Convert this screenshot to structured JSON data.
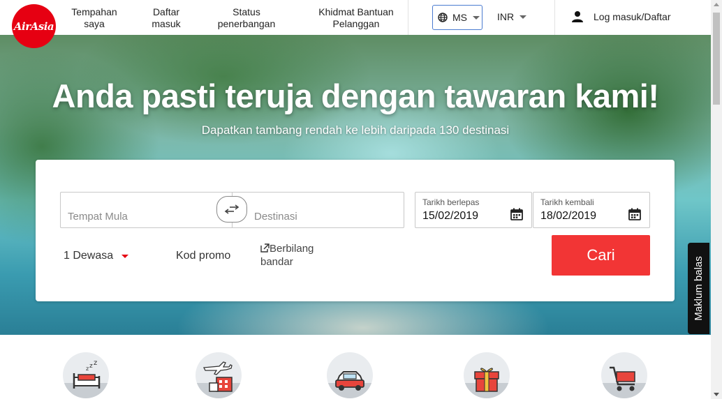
{
  "header": {
    "logo_text": "AirAsia",
    "nav": [
      "Tempahan saya",
      "Daftar masuk",
      "Status penerbangan",
      "Khidmat Bantuan Pelanggan"
    ],
    "language": "MS",
    "currency": "INR",
    "login": "Log masuk/Daftar"
  },
  "hero": {
    "title": "Anda pasti teruja dengan tawaran kami!",
    "subtitle": "Dapatkan tambang rendah ke lebih daripada 130 destinasi"
  },
  "search": {
    "origin_placeholder": "Tempat Mula",
    "destination_placeholder": "Destinasi",
    "depart_label": "Tarikh berlepas",
    "depart_value": "15/02/2019",
    "return_label": "Tarikh kembali",
    "return_value": "18/02/2019",
    "passengers": "1 Dewasa",
    "promo": "Kod promo",
    "multi_city": "Berbilang bandar",
    "search_button": "Cari"
  },
  "feedback": "Maklum balas",
  "colors": {
    "brand_red": "#e60012",
    "button_red": "#f23535",
    "focus_blue": "#4a7bd0"
  },
  "categories": [
    "hotel-icon",
    "flight-hotel-icon",
    "car-icon",
    "gift-icon",
    "shopping-cart-icon"
  ]
}
